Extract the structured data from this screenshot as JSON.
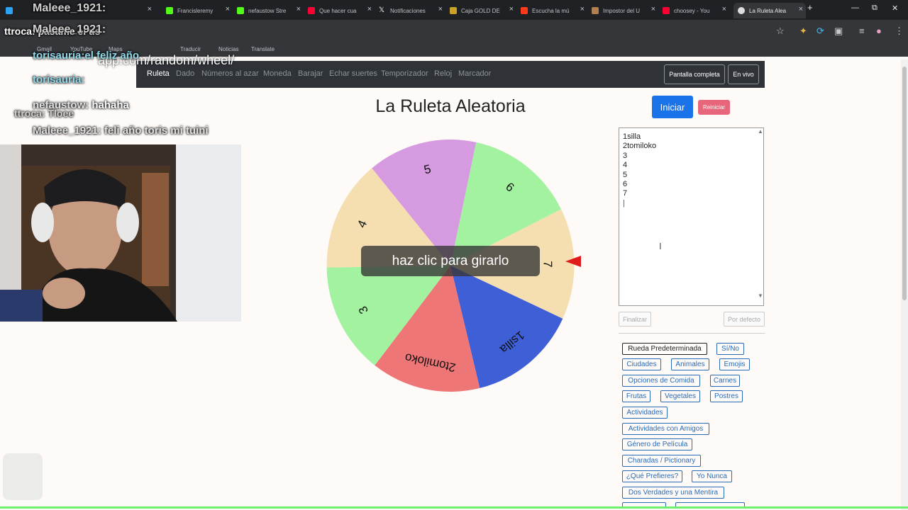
{
  "browser": {
    "tabs": [
      {
        "label": "",
        "color": "#2aa4f4"
      },
      {
        "label": "Francisleremy",
        "color": "#53fc18"
      },
      {
        "label": "nefaustow Stre",
        "color": "#53fc18"
      },
      {
        "label": "Que hacer cua",
        "color": "#ff0033"
      },
      {
        "label": "Notificaciones",
        "color": "#ffffff"
      },
      {
        "label": "Caja GOLD DE",
        "color": "#c9a227"
      },
      {
        "label": "Escucha la mú",
        "color": "#ff3a1a"
      },
      {
        "label": "Impostor del U",
        "color": "#b08050"
      },
      {
        "label": "choosey - You",
        "color": "#ff0033"
      },
      {
        "label": "La Ruleta Alea",
        "color": "#dddddd"
      }
    ],
    "new_tab": "+",
    "bookmarks": [
      "Gmail",
      "YouTube",
      "Maps",
      "Traducir",
      "Noticias",
      "Translate"
    ]
  },
  "overlay": {
    "url": "app.com/random/wheel/",
    "chat": [
      {
        "user": "Maleee_1921:",
        "msg": ""
      },
      {
        "user": "ttroca:",
        "msg": "pasame el us"
      },
      {
        "user": "Maleee_1921:",
        "msg": ""
      },
      {
        "user": "torisauria:",
        "msg": "el feliz año"
      },
      {
        "user": "torisauria:",
        "msg": ""
      },
      {
        "user": "nefaustow:",
        "msg": "hahaha"
      },
      {
        "user": "ttroca:",
        "msg": "Tloee"
      },
      {
        "user": "Maleee_1921:",
        "msg": "feli año toris mi tuini"
      }
    ]
  },
  "site": {
    "nav": {
      "items": [
        "Ruleta",
        "Dado",
        "Números al azar",
        "Moneda",
        "Barajar",
        "Echar suertes",
        "Temporizador",
        "Reloj",
        "Marcador"
      ],
      "fullscreen": "Pantalla completa",
      "live": "En vivo"
    },
    "title": "La Ruleta Aleatoria",
    "spin_prompt": "haz clic para girarlo",
    "wheel": {
      "segments": [
        {
          "label": "5",
          "color": "#d59ae0"
        },
        {
          "label": "6",
          "color": "#a3f2a0"
        },
        {
          "label": "7",
          "color": "#f5dfb1"
        },
        {
          "label": "1silla",
          "color": "#3f5fd6"
        },
        {
          "label": "2tomiloko",
          "color": "#ef7676"
        },
        {
          "label": "3",
          "color": "#a3f2a0"
        },
        {
          "label": "4",
          "color": "#f5dfb1"
        }
      ]
    },
    "start_label": "Iniciar",
    "reset_label": "Reiniciar",
    "entries": [
      "1silla",
      "2tomiloko",
      "3",
      "4",
      "5",
      "6",
      "7"
    ],
    "finish_label": "Finalizar",
    "default_label": "Por defecto",
    "presets": [
      "Rueda Predeterminada",
      "Sí/No",
      "Ciudades",
      "Animales",
      "Emojis",
      "Opciones de Comida",
      "Carnes",
      "Frutas",
      "Vegetales",
      "Postres",
      "Actividades",
      "Actividades con Amigos",
      "Género de Película",
      "Charadas / Pictionary",
      "¿Qué Prefieres?",
      "Yo Nunca",
      "Dos Verdades y una Mentira"
    ]
  }
}
